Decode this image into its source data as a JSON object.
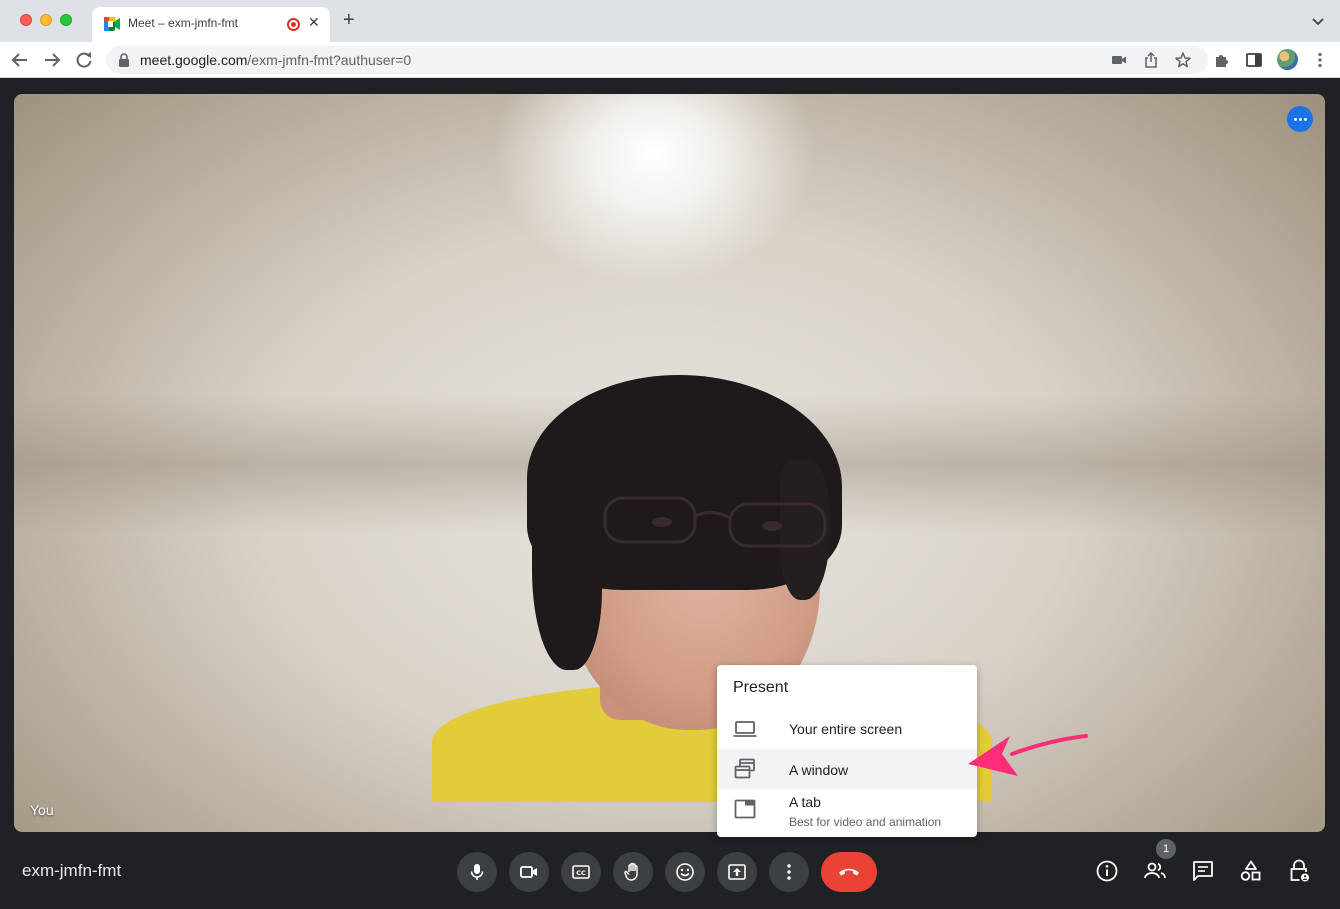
{
  "browser": {
    "tab_title": "Meet – exm-jmfn-fmt",
    "tab_close": "✕",
    "new_tab": "+",
    "url_host": "meet.google.com",
    "url_path": "/exm-jmfn-fmt?authuser=0"
  },
  "stage": {
    "self_label": "You",
    "more_options_icon": "more-horiz-icon"
  },
  "present_menu": {
    "title": "Present",
    "items": [
      {
        "label": "Your entire screen",
        "icon": "laptop-icon"
      },
      {
        "label": "A window",
        "icon": "window-icon",
        "highlighted": true
      },
      {
        "label": "A tab",
        "subtitle": "Best for video and animation",
        "icon": "tab-icon"
      }
    ]
  },
  "bottom_bar": {
    "meeting_code": "exm-jmfn-fmt",
    "participant_count": "1",
    "colors": {
      "end_call": "#ea4335",
      "control_bg": "#3c4043",
      "accent": "#1a73e8",
      "annotation_arrow": "#ff2d78"
    }
  }
}
